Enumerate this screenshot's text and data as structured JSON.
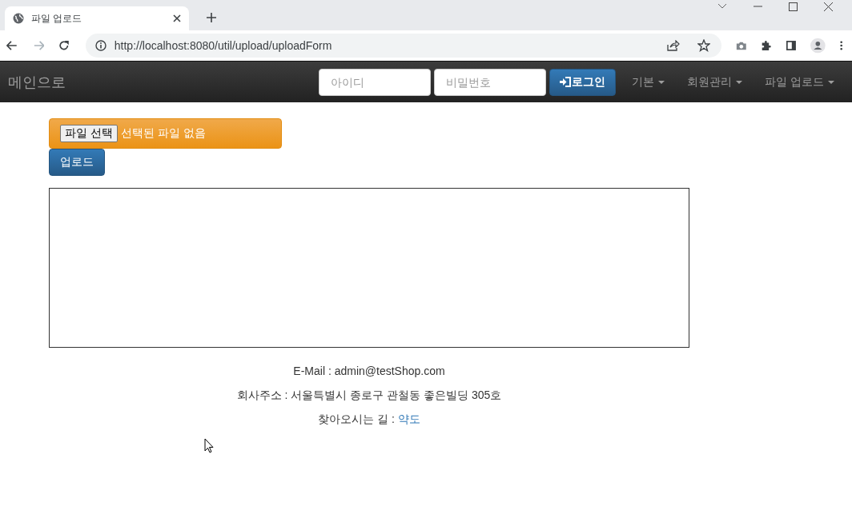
{
  "browser": {
    "tab_title": "파일 업로드",
    "url": "http://localhost:8080/util/upload/uploadForm"
  },
  "navbar": {
    "brand": "메인으로",
    "id_field": {
      "placeholder": "아이디"
    },
    "password_field": {
      "placeholder": "비밀번호"
    },
    "login_button": "로그인",
    "menus": [
      {
        "label": "기본"
      },
      {
        "label": "회원관리"
      },
      {
        "label": "파일 업로드"
      }
    ]
  },
  "upload_form": {
    "file_button": "파일 선택",
    "file_status": "선택된 파일 없음",
    "upload_button": "업로드"
  },
  "footer": {
    "email": "E-Mail : admin@testShop.com",
    "address": "회사주소 : 서울특별시 종로구 관철동 좋은빌딩 305호",
    "directions": "찾아오시는 길 : ",
    "map_link": "약도"
  }
}
